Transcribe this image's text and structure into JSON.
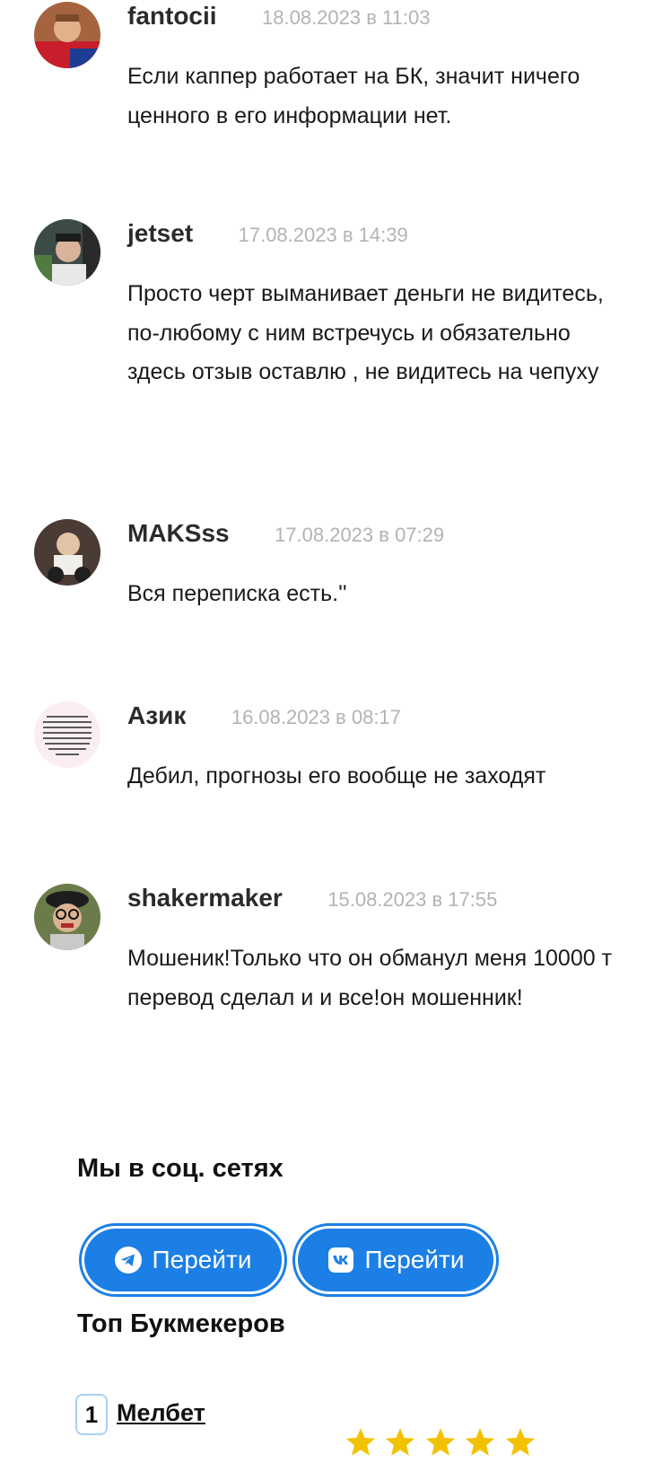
{
  "comments": [
    {
      "author": "fantocii",
      "date": "18.08.2023 в 11:03",
      "text": "Если каппер работает на БК, значит ничего ценного в его информации нет.",
      "avatar": "avatar-photo"
    },
    {
      "author": "jetset",
      "date": "17.08.2023 в 14:39",
      "text": "Просто черт выманивает деньги не видитесь, по-любому с ним встречусь и обязательно здесь отзыв оставлю , не видитесь на чепуху",
      "avatar": "avatar-photo"
    },
    {
      "author": "MAKSss",
      "date": "17.08.2023 в 07:29",
      "text": "Вся переписка есть.''",
      "avatar": "avatar-photo"
    },
    {
      "author": "Азик",
      "date": "16.08.2023 в 08:17",
      "text": "Дебил, прогнозы его вообще не заходят",
      "avatar": "avatar-text-image"
    },
    {
      "author": "shakermaker",
      "date": "15.08.2023 в 17:55",
      "text": "Мошеник!Только что он обманул меня 10000 т перевод сделал и и все!он мошенник!",
      "avatar": "avatar-photo"
    }
  ],
  "social": {
    "title": "Мы в соц. сетях",
    "telegram_label": "Перейти",
    "telegram_icon": "telegram-icon",
    "vk_label": "Перейти",
    "vk_icon": "vk-icon",
    "accent": "#1b7fe6"
  },
  "top": {
    "title": "Топ Букмекеров",
    "items": [
      {
        "rank": "1",
        "name": "Мелбет",
        "rating": 5
      }
    ],
    "star_color": "#f2c200"
  }
}
